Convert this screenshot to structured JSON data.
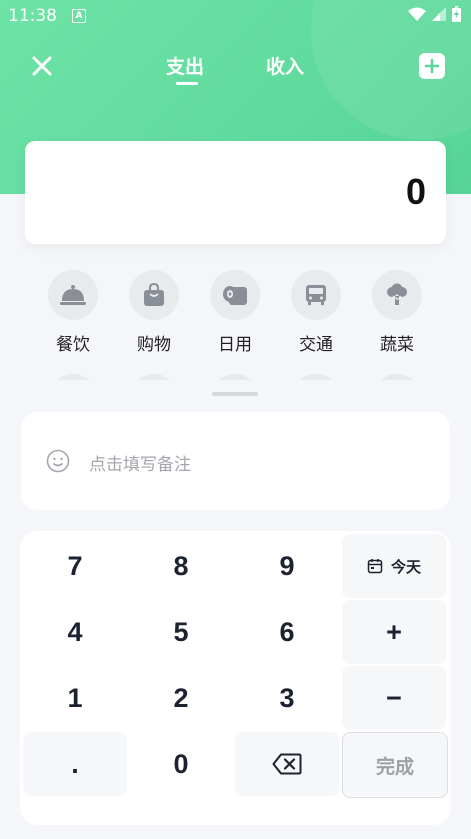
{
  "status_bar": {
    "time": "11:38",
    "notification": "A"
  },
  "header": {
    "tabs": [
      {
        "label": "支出",
        "active": true
      },
      {
        "label": "收入",
        "active": false
      }
    ],
    "close_icon": "close-icon",
    "add_icon": "plus-icon",
    "accent_color": "#5bd49a"
  },
  "amount": {
    "value": "0"
  },
  "categories": [
    {
      "label": "餐饮",
      "icon": "dining-cloche-icon"
    },
    {
      "label": "购物",
      "icon": "shopping-bag-icon"
    },
    {
      "label": "日用",
      "icon": "toilet-roll-icon"
    },
    {
      "label": "交通",
      "icon": "bus-icon"
    },
    {
      "label": "蔬菜",
      "icon": "broccoli-icon"
    }
  ],
  "note": {
    "placeholder": "点击填写备注",
    "icon": "smile-icon"
  },
  "keypad": {
    "keys": [
      "7",
      "8",
      "9",
      "4",
      "5",
      "6",
      "1",
      "2",
      "3",
      ".",
      "0"
    ],
    "date_label": "今天",
    "plus": "+",
    "minus": "−",
    "done": "完成",
    "backspace_icon": "backspace-icon"
  }
}
